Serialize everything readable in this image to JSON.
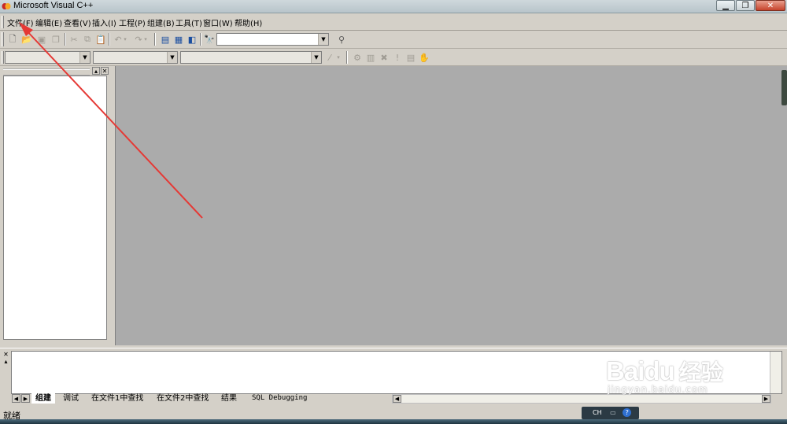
{
  "window": {
    "title": "Microsoft Visual C++"
  },
  "menubar": {
    "items": [
      "文件(F)",
      "编辑(E)",
      "查看(V)",
      "插入(I)",
      "工程(P)",
      "组建(B)",
      "工具(T)",
      "窗口(W)",
      "帮助(H)"
    ]
  },
  "output": {
    "tabs": [
      "组建",
      "调试",
      "在文件1中查找",
      "在文件2中查找",
      "结果",
      "SQL Debugging"
    ]
  },
  "statusbar": {
    "text": "就绪",
    "lang": "CH"
  },
  "watermark": {
    "logo": "Bai",
    "logo2": "du",
    "cn": "经验",
    "url": "jingyan.baidu.com"
  },
  "colors": {
    "mdi_background": "#ababab",
    "chrome": "#d4d0c8",
    "annotation_arrow": "#e53935"
  }
}
